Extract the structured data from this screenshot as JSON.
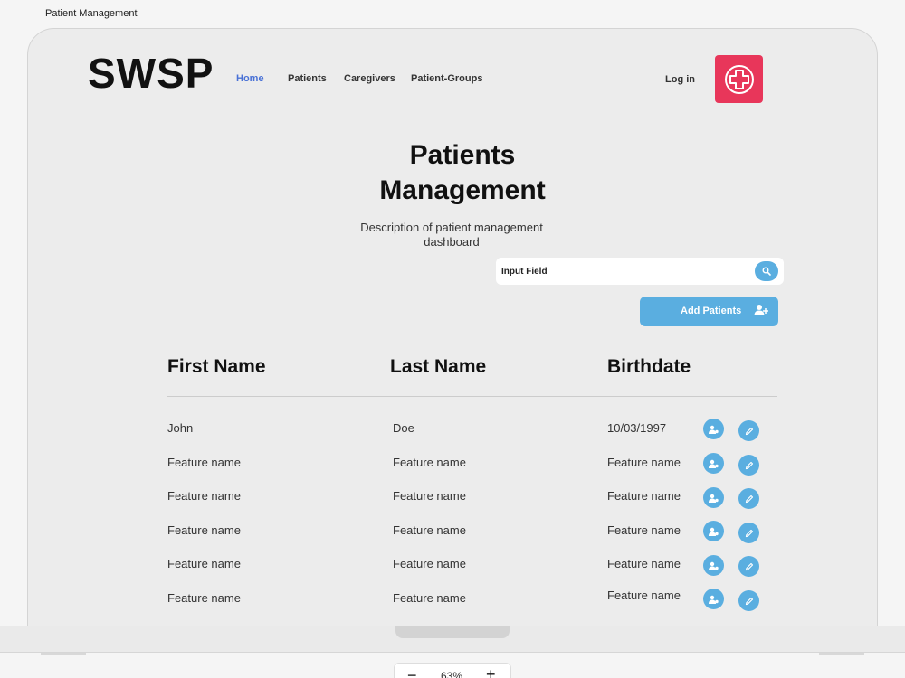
{
  "frame_title": "Patient Management",
  "header": {
    "brand": "SWSP",
    "nav": [
      {
        "label": "Home",
        "active": true
      },
      {
        "label": "Patients",
        "active": false
      },
      {
        "label": "Caregivers",
        "active": false
      },
      {
        "label": "Patient-Groups",
        "active": false
      }
    ],
    "login": "Log in",
    "logo_icon": "medical-cross-icon",
    "logo_color": "#e8365a"
  },
  "main": {
    "title_line1": "Patients",
    "title_line2": "Management",
    "description_line1": "Description of patient management",
    "description_line2": "dashboard",
    "search": {
      "placeholder": "Input Field",
      "icon": "search-icon"
    },
    "add_button": {
      "label": "Add Patients",
      "icon": "add-user-icon"
    }
  },
  "table": {
    "columns": [
      "First Name",
      "Last Name",
      "Birthdate"
    ],
    "rows": [
      [
        "John",
        "Doe",
        "10/03/1997"
      ],
      [
        "Feature name",
        "Feature name",
        "Feature name"
      ],
      [
        "Feature name",
        "Feature name",
        "Feature name"
      ],
      [
        "Feature name",
        "Feature name",
        "Feature name"
      ],
      [
        "Feature name",
        "Feature name",
        "Feature name"
      ],
      [
        "Feature name",
        "Feature name",
        "Feature name"
      ]
    ],
    "row_action_icons": [
      "user-settings-icon",
      "edit-pencil-icon"
    ]
  },
  "zoom": {
    "value": "63%"
  },
  "colors": {
    "accent": "#5aaee0",
    "nav_active": "#4a72d6"
  }
}
